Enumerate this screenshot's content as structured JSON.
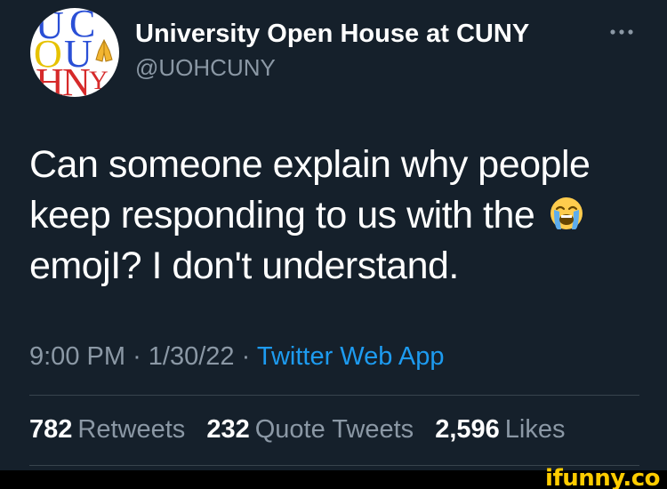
{
  "tweet": {
    "author": {
      "display_name": "University Open House at CUNY",
      "handle": "@UOHCUNY",
      "avatar_letters": [
        "U",
        "C",
        "O",
        "U",
        "H",
        "N",
        "Y"
      ]
    },
    "more_icon": "more-horizontal-icon",
    "text_line_1": "Can someone explain why people",
    "text_line_2": "keep responding to us with the",
    "text_line_2_emoji": "loudly-crying-face-emoji",
    "text_line_3": "emojI? I don't understand.",
    "meta": {
      "time": "9:00 PM",
      "separator": "·",
      "date": "1/30/22",
      "source": "Twitter Web App"
    },
    "stats": {
      "retweets_count": "782",
      "retweets_label": "Retweets",
      "quotes_count": "232",
      "quotes_label": "Quote Tweets",
      "likes_count": "2,596",
      "likes_label": "Likes"
    }
  },
  "watermark": "ifunny.co",
  "colors": {
    "background": "#15202b",
    "text": "#ffffff",
    "muted": "#8b98a5",
    "link": "#1d9bf0",
    "divider": "#38444d",
    "watermark": "#ffcc00"
  }
}
